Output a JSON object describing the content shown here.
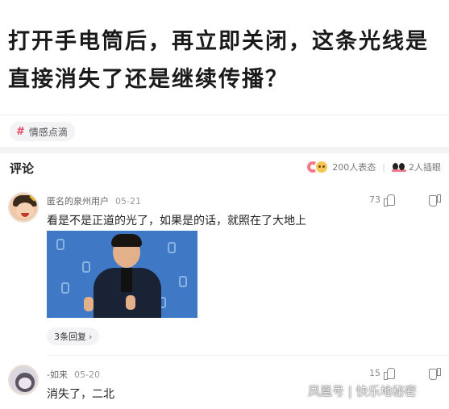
{
  "question": {
    "title": "打开手电筒后，再立即关闭，这条光线是直接消失了还是继续传播？"
  },
  "topic_tag": {
    "symbol": "#",
    "label": "情感点滴"
  },
  "comments_header": {
    "title": "评论",
    "reactions_label": "200人表态",
    "separator": "|",
    "participants_label": "2人插眼",
    "colors": {
      "reaction_pink": "#f37a8b",
      "reaction_yellow": "#f7c653"
    }
  },
  "comments": [
    {
      "user": "匿名的泉州用户",
      "date": "05-21",
      "likes": "73",
      "text": "看是不是正道的光了，如果是的话，就照在了大地上",
      "image_icon": "photo-man-thumbs-up",
      "replies_label": "3条回复",
      "replies_chevron": "›"
    },
    {
      "user": "-如来",
      "date": "05-20",
      "likes": "15",
      "text": "消失了，二北"
    }
  ],
  "watermark": {
    "text": "凤凰号 | 快乐地秘密"
  }
}
